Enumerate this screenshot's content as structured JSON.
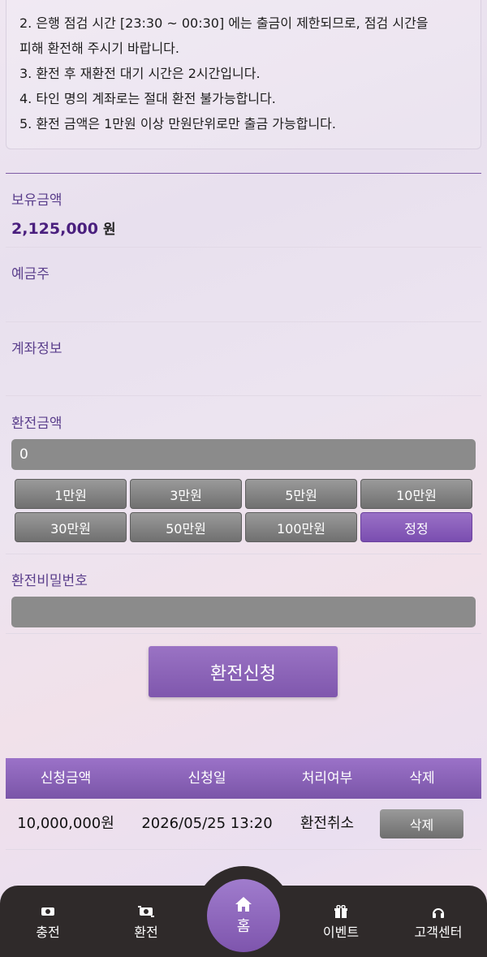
{
  "notice": {
    "lines": [
      "2. 은행 점검 시간 [23:30 ~ 00:30] 에는 출금이 제한되므로, 점검 시간을",
      "피해 환전해 주시기 바랍니다.",
      "3. 환전 후 재환전 대기 시간은 2시간입니다.",
      "4. 타인 명의 계좌로는 절대 환전 불가능합니다.",
      "5. 환전 금액은 1만원 이상 만원단위로만 출금 가능합니다."
    ]
  },
  "balance": {
    "label": "보유금액",
    "amount": "2,125,000",
    "unit": "원"
  },
  "depositor": {
    "label": "예금주",
    "value": ""
  },
  "account": {
    "label": "계좌정보",
    "value": ""
  },
  "exchange": {
    "label": "환전금액",
    "value": "0",
    "quick_buttons": [
      "1만원",
      "3만원",
      "5만원",
      "10만원",
      "30만원",
      "50만원",
      "100만원"
    ],
    "reset_label": "정정"
  },
  "password": {
    "label": "환전비밀번호",
    "value": ""
  },
  "submit_label": "환전신청",
  "table": {
    "headers": [
      "신청금액",
      "신청일",
      "처리여부",
      "삭제"
    ],
    "rows": [
      {
        "amount": "10,000,000원",
        "date": "2026/05/25 13:20",
        "status": "환전취소",
        "delete_label": "삭제"
      }
    ]
  },
  "nav": {
    "items": [
      {
        "label": "충전",
        "icon": "money-icon"
      },
      {
        "label": "환전",
        "icon": "exchange-icon"
      },
      {
        "label": "홈",
        "icon": "home-icon"
      },
      {
        "label": "이벤트",
        "icon": "gift-icon"
      },
      {
        "label": "고객센터",
        "icon": "headset-icon"
      }
    ]
  },
  "colors": {
    "accent": "#7f57ad",
    "nav_bg": "#2f2a2a",
    "input_bg": "#8b8b8b"
  }
}
